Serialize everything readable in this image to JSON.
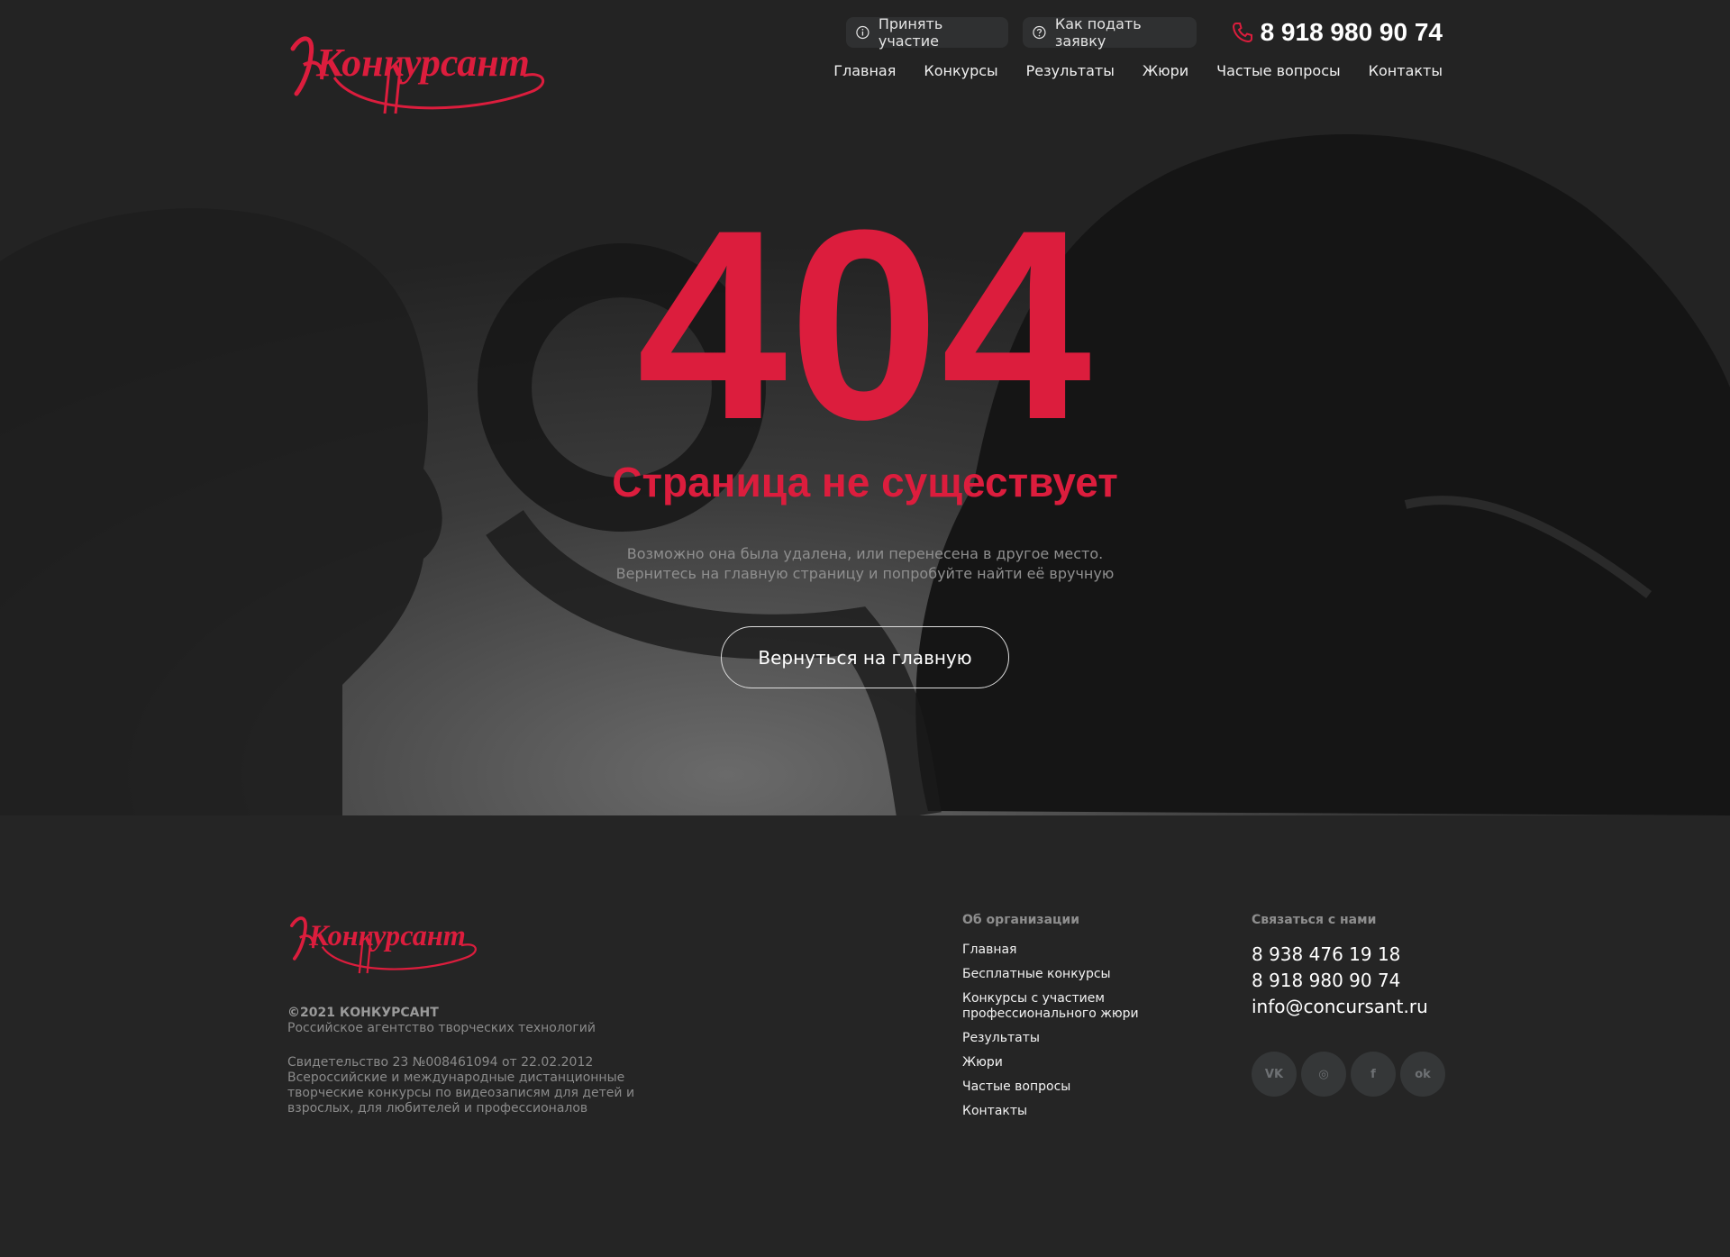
{
  "brand": {
    "logo_text": "Конкурсант",
    "accent_color": "#dc1d3d"
  },
  "header": {
    "actions": [
      {
        "label": "Принять участие",
        "icon": "info-icon"
      },
      {
        "label": "Как подать заявку",
        "icon": "question-icon"
      }
    ],
    "phone": "8 918 980 90 74",
    "nav": [
      "Главная",
      "Конкурсы",
      "Результаты",
      "Жюри",
      "Частые вопросы",
      "Контакты"
    ]
  },
  "error": {
    "code": "404",
    "title": "Страница не существует",
    "description_line1": "Возможно она была удалена, или перенесена в другое место.",
    "description_line2": "Вернитесь на главную страницу и попробуйте найти её вручную",
    "button_label": "Вернуться на главную"
  },
  "footer": {
    "copyright": "©2021 КОНКУРСАНТ",
    "tagline": "Российское агентство творческих технологий",
    "certificate": "Свидетельство 23 №008461094 от 22.02.2012",
    "about_text": "Всероссийские и международные дистанционные творческие конкурсы по видеозаписям для детей и взрослых, для любителей и профессионалов",
    "about_title": "Об организации",
    "links": [
      "Главная",
      "Бесплатные конкурсы",
      "Конкурсы с участием профессионального жюри",
      "Результаты",
      "Жюри",
      "Частые вопросы",
      "Контакты"
    ],
    "contact_title": "Связаться с нами",
    "phones": [
      "8 938 476 19 18",
      "8 918 980 90 74"
    ],
    "email": "info@concursant.ru",
    "socials": [
      {
        "icon": "vk-icon",
        "glyph": "VK"
      },
      {
        "icon": "instagram-icon",
        "glyph": "◎"
      },
      {
        "icon": "facebook-icon",
        "glyph": "f"
      },
      {
        "icon": "odnoklassniki-icon",
        "glyph": "ok"
      }
    ]
  }
}
